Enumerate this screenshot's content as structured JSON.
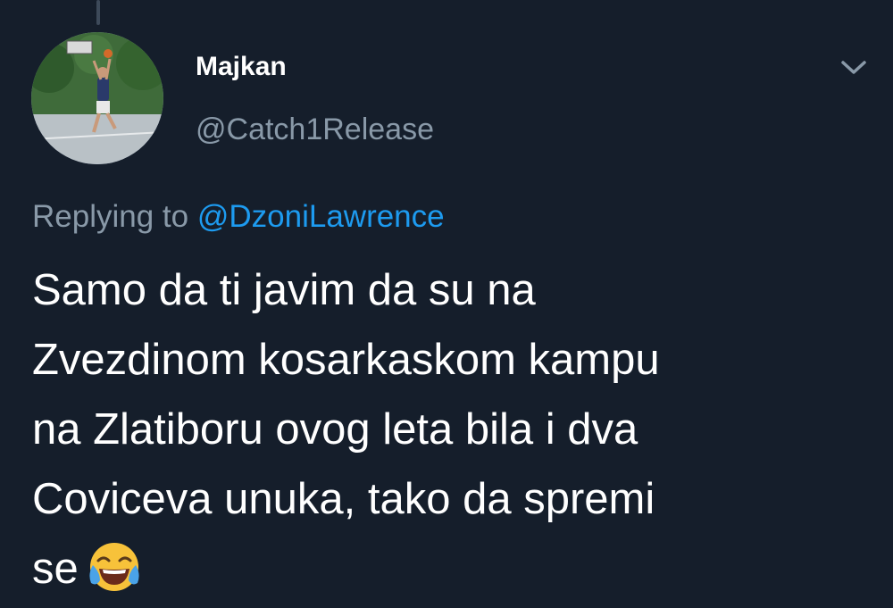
{
  "tweet": {
    "author": {
      "display_name": "Majkan",
      "handle": "@Catch1Release",
      "avatar_description": "avatar"
    },
    "reply": {
      "prefix": "Replying to",
      "mention": "@DzoniLawrence"
    },
    "body_lines": [
      "Samo da ti javim da su na",
      "Zvezdinom kosarkaskom kampu",
      "na Zlatiboru ovog leta bila i dva",
      "Coviceva unuka, tako da spremi",
      "se"
    ],
    "emoji": "face-with-tears-of-joy",
    "menu_icon": "chevron-down-icon"
  },
  "colors": {
    "background": "#151e2b",
    "primary_text": "#ffffff",
    "secondary_text": "#8999a8",
    "link": "#1d9bf0"
  }
}
